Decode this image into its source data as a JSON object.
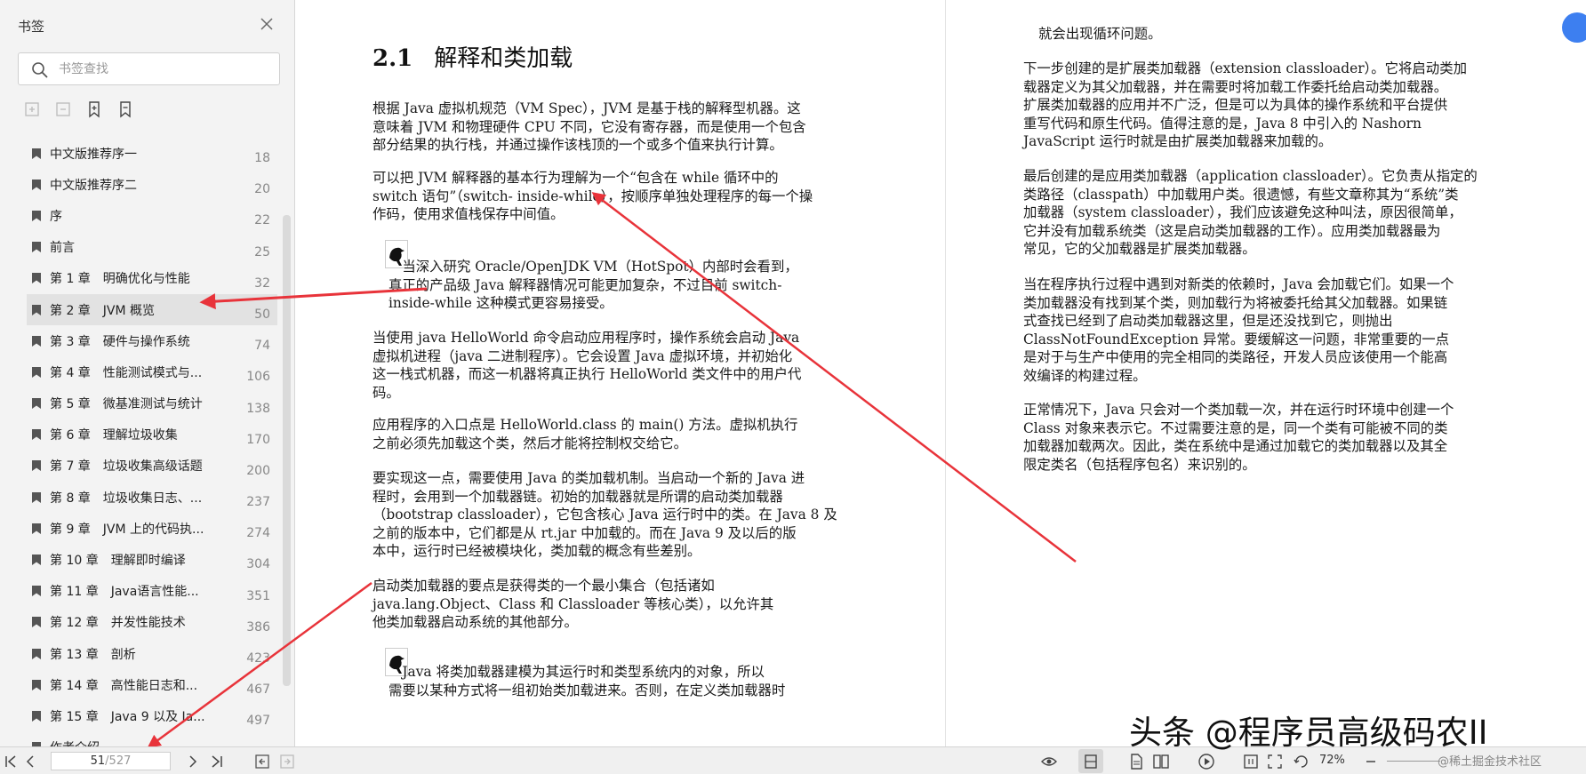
{
  "sidebar": {
    "title": "书签",
    "search_placeholder": "书签查找",
    "bookmarks": [
      {
        "label": "中文版推荐序一",
        "page": "18"
      },
      {
        "label": "中文版推荐序二",
        "page": "20"
      },
      {
        "label": "序",
        "page": "22"
      },
      {
        "label": "前言",
        "page": "25"
      },
      {
        "label": "第 1 章　明确优化与性能",
        "page": "32"
      },
      {
        "label": "第 2 章　JVM 概览",
        "page": "50"
      },
      {
        "label": "第 3 章　硬件与操作系统",
        "page": "74"
      },
      {
        "label": "第 4 章　性能测试模式与...",
        "page": "106"
      },
      {
        "label": "第 5 章　微基准测试与统计",
        "page": "138"
      },
      {
        "label": "第 6 章　理解垃圾收集",
        "page": "170"
      },
      {
        "label": "第 7 章　垃圾收集高级话题",
        "page": "200"
      },
      {
        "label": "第 8 章　垃圾收集日志、...",
        "page": "237"
      },
      {
        "label": "第 9 章　JVM 上的代码执...",
        "page": "274"
      },
      {
        "label": "第 10 章　理解即时编译",
        "page": "304"
      },
      {
        "label": "第 11 章　Java语言性能...",
        "page": "351"
      },
      {
        "label": "第 12 章　并发性能技术",
        "page": "386"
      },
      {
        "label": "第 13 章　剖析",
        "page": "423"
      },
      {
        "label": "第 14 章　高性能日志和...",
        "page": "467"
      },
      {
        "label": "第 15 章　Java 9 以及 Ja...",
        "page": "497"
      },
      {
        "label": "作者介绍",
        "page": ""
      }
    ],
    "selected_index": 5
  },
  "left_page": {
    "heading_num": "2.1",
    "heading_text": "解释和类加载",
    "p1": [
      "根据 Java 虚拟机规范（VM Spec），JVM 是基于栈的解释型机器。这",
      "意味着 JVM 和物理硬件 CPU 不同，它没有寄存器，而是使用一个包含",
      "部分结果的执行栈，并通过操作该栈顶的一个或多个值来执行计算。"
    ],
    "p2": [
      "可以把 JVM 解释器的基本行为理解为一个“包含在 while 循环中的",
      "switch 语句”（switch- inside-while），按顺序单独处理程序的每一个操",
      "作码，使用求值栈保存中间值。"
    ],
    "note1": [
      "　当深入研究 Oracle/OpenJDK VM（HotSpot）内部时会看到，",
      "真正的产品级 Java 解释器情况可能更加复杂，不过目前 switch-",
      "inside-while 这种模式更容易接受。"
    ],
    "p3": [
      "当使用 java HelloWorld 命令启动应用程序时，操作系统会启动 Java",
      "虚拟机进程（java 二进制程序）。它会设置 Java 虚拟环境，并初始化",
      "这一栈式机器，而这一机器将真正执行 HelloWorld 类文件中的用户代",
      "码。"
    ],
    "p4": [
      "应用程序的入口点是 HelloWorld.class 的 main() 方法。虚拟机执行",
      "之前必须先加载这个类，然后才能将控制权交给它。"
    ],
    "p5": [
      "要实现这一点，需要使用 Java 的类加载机制。当启动一个新的 Java 进",
      "程时，会用到一个加载器链。初始的加载器就是所谓的启动类加载器",
      "（bootstrap classloader），它包含核心 Java 运行时中的类。在 Java 8 及",
      "之前的版本中，它们都是从 rt.jar 中加载的。而在 Java 9 及以后的版",
      "本中，运行时已经被模块化，类加载的概念有些差别。"
    ],
    "p6": [
      "启动类加载器的要点是获得类的一个最小集合（包括诸如",
      "java.lang.Object、Class 和 Classloader 等核心类），以允许其",
      "他类加载器启动系统的其他部分。"
    ],
    "note2": [
      "　Java 将类加载器建模为其运行时和类型系统内的对象，所以",
      "需要以某种方式将一组初始类加载进来。否则，在定义类加载器时"
    ]
  },
  "right_page": {
    "p0": [
      "就会出现循环问题。"
    ],
    "p1": [
      "下一步创建的是扩展类加载器（extension classloader）。它将启动类加",
      "载器定义为其父加载器，并在需要时将加载工作委托给启动类加载器。",
      "扩展类加载器的应用并不广泛，但是可以为具体的操作系统和平台提供",
      "重写代码和原生代码。值得注意的是，Java 8 中引入的 Nashorn",
      "JavaScript 运行时就是由扩展类加载器来加载的。"
    ],
    "p2": [
      "最后创建的是应用类加载器（application classloader）。它负责从指定的",
      "类路径（classpath）中加载用户类。很遗憾，有些文章称其为“系统”类",
      "加载器（system classloader），我们应该避免这种叫法，原因很简单，",
      "它并没有加载系统类（这是启动类加载器的工作）。应用类加载器最为",
      "常见，它的父加载器是扩展类加载器。"
    ],
    "p3": [
      "当在程序执行过程中遇到对新类的依赖时，Java 会加载它们。如果一个",
      "类加载器没有找到某个类，则加载行为将被委托给其父加载器。如果链",
      "式查找已经到了启动类加载器这里，但是还没找到它，则抛出",
      "ClassNotFoundException 异常。要缓解这一问题，非常重要的一点",
      "是对于与生产中使用的完全相同的类路径，开发人员应该使用一个能高",
      "效编译的构建过程。"
    ],
    "p4": [
      "正常情况下，Java 只会对一个类加载一次，并在运行时环境中创建一个",
      "Class 对象来表示它。不过需要注意的是，同一个类有可能被不同的类",
      "加载器加载两次。因此，类在系统中是通过加载它的类加载器以及其全",
      "限定类名（包括程序包名）来识别的。"
    ]
  },
  "statusbar": {
    "current_page": "51",
    "total_pages": "/527",
    "zoom": "72%"
  },
  "watermark": {
    "main": "头条 @程序员高级码农II",
    "sub": "@稀土掘金技术社区"
  },
  "colors": {
    "arrow": "#e8333a",
    "accent": "#3d7ff0"
  }
}
